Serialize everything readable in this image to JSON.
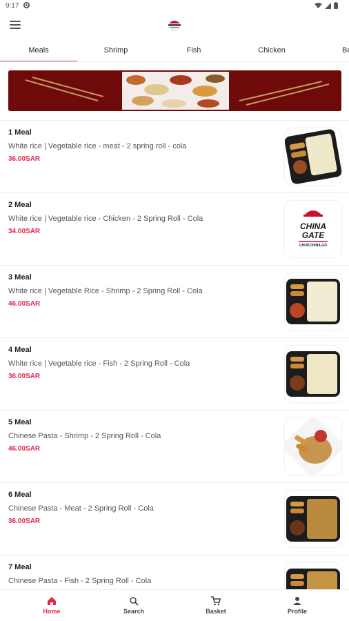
{
  "status_bar": {
    "time": "9:17"
  },
  "tabs": [
    {
      "label": "Meals"
    },
    {
      "label": "Shrimp"
    },
    {
      "label": "Fish"
    },
    {
      "label": "Chicken"
    },
    {
      "label": "Be"
    }
  ],
  "meals": [
    {
      "title": "1 Meal",
      "description": "White rice | Vegetable rice - meat - 2 spring roll - cola",
      "price": "36.00SAR"
    },
    {
      "title": "2 Meal",
      "description": "White rice | Vegetable rice - Chicken - 2 Spring Roll - Cola",
      "price": "34.00SAR"
    },
    {
      "title": "3 Meal",
      "description": "White rice | Vegetable Rice - Shrimp - 2 Spring Roll - Cola",
      "price": "46.00SAR"
    },
    {
      "title": "4 Meal",
      "description": "White rice | Vegetable rice - Fish - 2 Spring Roll - Cola",
      "price": "36.00SAR"
    },
    {
      "title": "5 Meal",
      "description": "Chinese Pasta - Shrimp - 2 Spring Roll - Cola",
      "price": "46.00SAR"
    },
    {
      "title": "6 Meal",
      "description": "Chinese Pasta - Meat - 2 Spring Roll - Cola",
      "price": "36.00SAR"
    },
    {
      "title": "7 Meal",
      "description": "Chinese Pasta - Fish - 2 Spring Roll - Cola",
      "price": ""
    }
  ],
  "logo_card": {
    "line1": "CHINA",
    "line2": "GATE",
    "line3": "CHOP.CHINA.GO"
  },
  "bottom_nav": [
    {
      "label": "Home",
      "icon": "home-icon"
    },
    {
      "label": "Search",
      "icon": "search-icon"
    },
    {
      "label": "Basket",
      "icon": "cart-icon"
    },
    {
      "label": "Profile",
      "icon": "person-icon"
    }
  ],
  "colors": {
    "accent": "#e5274a",
    "banner": "#6e0a0a"
  }
}
